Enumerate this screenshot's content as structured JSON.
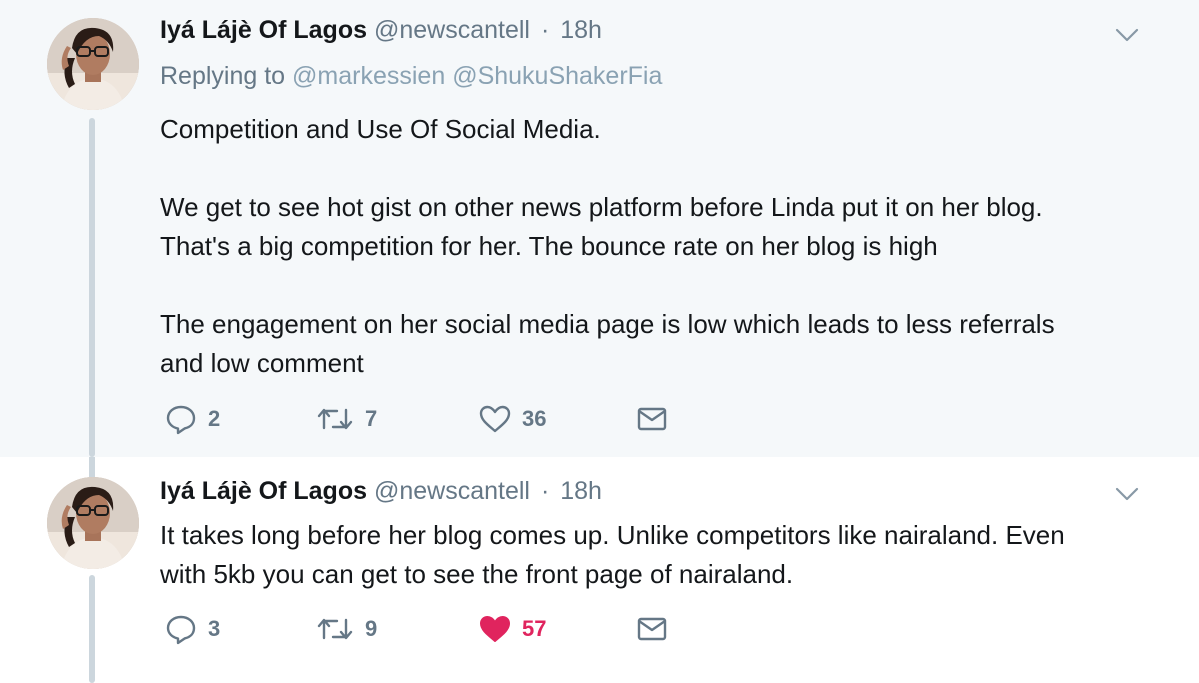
{
  "tweets": [
    {
      "author_name": "Iyá Lájè Of Lagos",
      "handle": "@newscantell",
      "separator": "·",
      "time": "18h",
      "replying_prefix": "Replying to",
      "replying_to": [
        "@markessien",
        "@ShukuShakerFia"
      ],
      "text_lines": [
        "Competition and Use Of Social Media.",
        "",
        "We get to see hot gist on other news platform before Linda put it on her blog.",
        "That's a big competition for her. The bounce rate on her blog is high",
        "",
        "The engagement on her social media page is low which leads to less referrals",
        "and low comment"
      ],
      "reply_count": "2",
      "retweet_count": "7",
      "like_count": "36",
      "liked": false
    },
    {
      "author_name": "Iyá Lájè Of Lagos",
      "handle": "@newscantell",
      "separator": "·",
      "time": "18h",
      "text_lines": [
        "It takes long before her blog comes up. Unlike competitors like nairaland. Even",
        "with 5kb you can get to see the front page of nairaland."
      ],
      "reply_count": "3",
      "retweet_count": "9",
      "like_count": "57",
      "liked": true
    }
  ],
  "colors": {
    "background_highlight": "#f5f8fa",
    "text": "#14171a",
    "secondary_text": "#657786",
    "mention": "#8aa2b3",
    "like": "#e0245e",
    "thread_line": "#ccd6dd"
  },
  "icons": [
    "chevron-down-icon",
    "reply-icon",
    "retweet-icon",
    "heart-icon",
    "heart-filled-icon",
    "envelope-icon"
  ]
}
